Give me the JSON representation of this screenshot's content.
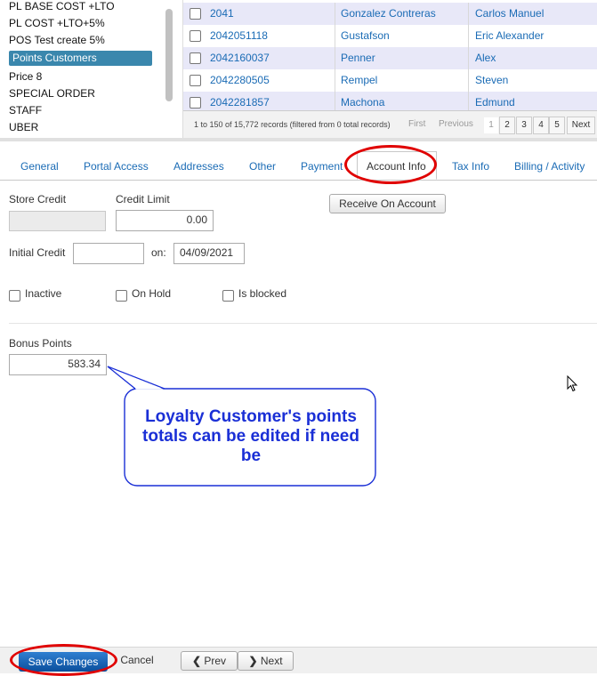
{
  "price_list": {
    "items": [
      "PL BASE COST +LTO",
      "PL COST +LTO+5%",
      "POS Test create 5%",
      "Points Customers",
      "Price 8",
      "SPECIAL ORDER",
      "STAFF",
      "UBER"
    ],
    "selected": "Points Customers"
  },
  "customers_table": {
    "rows": [
      {
        "id": "2041",
        "last": "Gonzalez Contreras",
        "first": "Carlos Manuel"
      },
      {
        "id": "2042051118",
        "last": "Gustafson",
        "first": "Eric Alexander"
      },
      {
        "id": "2042160037",
        "last": "Penner",
        "first": "Alex"
      },
      {
        "id": "2042280505",
        "last": "Rempel",
        "first": "Steven"
      },
      {
        "id": "2042281857",
        "last": "Machona",
        "first": "Edmund"
      }
    ],
    "info": "1 to 150 of 15,772 records (filtered from 0 total records)",
    "pager": {
      "first": "First",
      "previous": "Previous",
      "pages": [
        "1",
        "2",
        "3",
        "4",
        "5"
      ],
      "next": "Next"
    }
  },
  "tabs": [
    "General",
    "Portal Access",
    "Addresses",
    "Other",
    "Payment",
    "Account Info",
    "Tax Info",
    "Billing / Activity"
  ],
  "active_tab": "Account Info",
  "account_info": {
    "store_credit_label": "Store Credit",
    "store_credit_value": "",
    "credit_limit_label": "Credit Limit",
    "credit_limit_value": "0.00",
    "receive_button": "Receive On Account",
    "initial_credit_label": "Initial Credit",
    "initial_credit_value": "",
    "on_label": "on:",
    "on_date": "04/09/2021",
    "inactive_label": "Inactive",
    "on_hold_label": "On Hold",
    "is_blocked_label": "Is blocked",
    "bonus_points_label": "Bonus Points",
    "bonus_points_value": "583.34"
  },
  "callout": {
    "lines": [
      "Loyalty Customer's points",
      "totals can be edited if need",
      "be"
    ],
    "color": "#1a2fd6"
  },
  "bottom_bar": {
    "save": "Save Changes",
    "cancel": "Cancel",
    "prev": "Prev",
    "next": "Next"
  },
  "colors": {
    "accent": "#3a87ad",
    "link": "#1a6bb5",
    "highlight_ring": "#e00000",
    "save_button": "#1a5fb4"
  }
}
